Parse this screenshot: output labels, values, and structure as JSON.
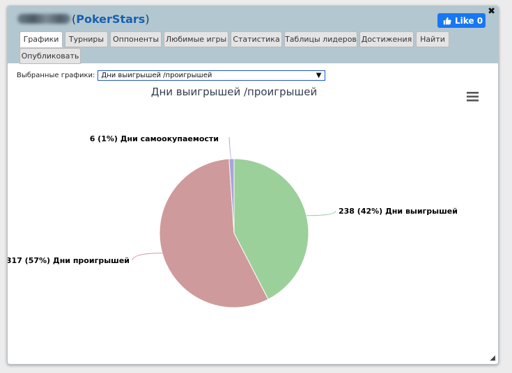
{
  "header": {
    "site_paren_open": "(",
    "site_name": "PokerStars",
    "site_paren_close": ")",
    "like_label": "Like 0",
    "close_glyph": "✖"
  },
  "tabs": [
    {
      "label": "Графики",
      "active": true
    },
    {
      "label": "Турниры"
    },
    {
      "label": "Оппоненты"
    },
    {
      "label": "Любимые игры"
    },
    {
      "label": "Статистика"
    },
    {
      "label": "Таблицы лидеров"
    },
    {
      "label": "Достижения"
    },
    {
      "label": "Найти"
    },
    {
      "label": "Опубликовать"
    }
  ],
  "selector": {
    "label": "Выбранные графики:",
    "value": "Дни выигрышей /проигрышей",
    "arrow": "▼"
  },
  "chart_menu_icon": "hamburger-menu-icon",
  "chart_data": {
    "type": "pie",
    "title": "Дни выигрышей /проигрышей",
    "series": [
      {
        "name": "Дни выигрышей",
        "value": 238,
        "percent": 42,
        "label": "238 (42%) Дни выигрышей",
        "color": "#9bd09a"
      },
      {
        "name": "Дни проигрышей",
        "value": 317,
        "percent": 57,
        "label": "317 (57%) Дни проигрышей",
        "color": "#cf9a9b"
      },
      {
        "name": "Дни самоокупаемости",
        "value": 6,
        "percent": 1,
        "label": "6 (1%) Дни самоокупаемости",
        "color": "#a9a3dc"
      }
    ]
  },
  "resize_glyph": "◢"
}
